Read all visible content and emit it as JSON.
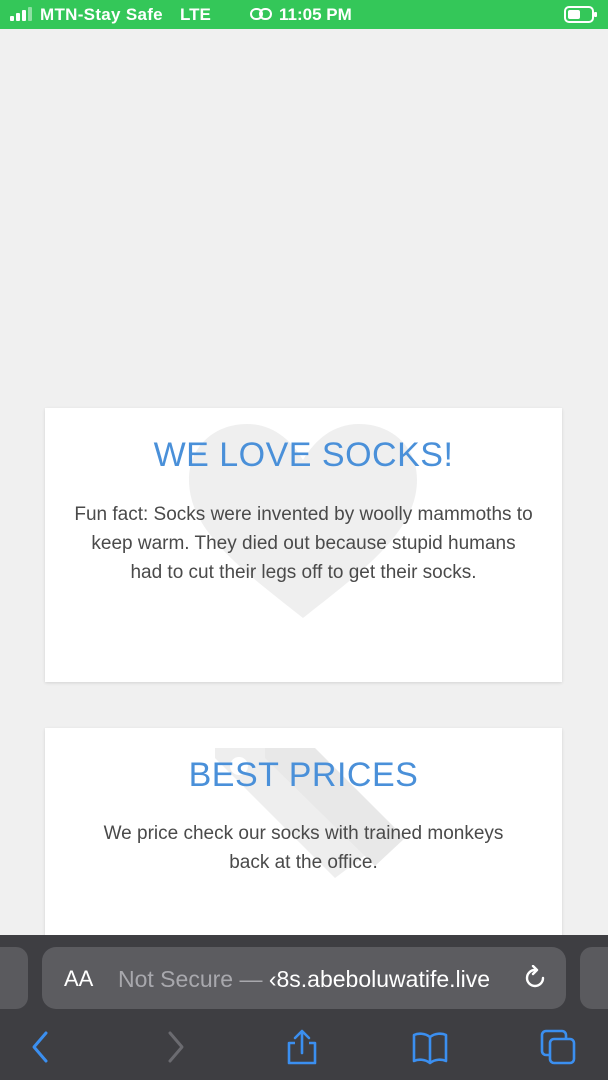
{
  "status_bar": {
    "carrier": "MTN-Stay Safe",
    "network": "LTE",
    "time": "11:05 PM",
    "icons": [
      "signal-icon",
      "link-icon",
      "battery-icon"
    ]
  },
  "cards": [
    {
      "title": "WE LOVE SOCKS!",
      "body": "Fun fact: Socks were invented by woolly mammoths to keep warm. They died out because stupid humans had to cut their legs off to get their socks.",
      "watermark_icon": "heart-icon"
    },
    {
      "title": "BEST PRICES",
      "body": "We price check our socks with trained monkeys back at the office.",
      "watermark_icon": "price-tags-icon"
    }
  ],
  "browser": {
    "reader_label": "AA",
    "not_secure": "Not Secure",
    "separator": "—",
    "url": "‹8s.abeboluwatife.live",
    "toolbar": [
      "back-icon",
      "forward-icon",
      "share-icon",
      "bookmarks-icon",
      "tabs-icon"
    ]
  },
  "colors": {
    "status_bar": "#34c759",
    "accent_title": "#4a90d9",
    "toolbar_icon": "#3b8ff0",
    "page_bg": "#f0f0f0"
  }
}
